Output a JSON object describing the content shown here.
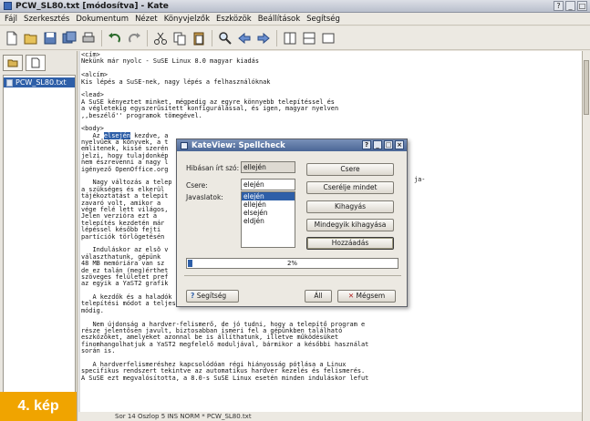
{
  "window": {
    "title": "PCW_SL80.txt [módosítva] - Kate"
  },
  "menu": [
    "Fájl",
    "Szerkesztés",
    "Dokumentum",
    "Nézet",
    "Könyvjelzők",
    "Eszközök",
    "Beállítások",
    "Segítség"
  ],
  "toolbar_icons": [
    "new-icon",
    "open-icon",
    "save-icon",
    "save-all-icon",
    "print-icon",
    "undo-icon",
    "redo-icon",
    "cut-icon",
    "copy-icon",
    "paste-icon",
    "find-icon",
    "back-icon",
    "forward-icon",
    "split-vertical-icon",
    "split-horizontal-icon",
    "close-view-icon"
  ],
  "sidebar": {
    "file": "PCW_SL80.txt"
  },
  "editor": {
    "lines": [
      "<cím>",
      "Nekünk már nyolc - SuSE Linux 8.0 magyar kiadás",
      "",
      "<alcím>",
      "Kis lépés a SuSE-nek, nagy lépés a felhasználóknak",
      "",
      "<lead>",
      "A SuSE kényeztet minket, mégpedig az egyre könnyebb telepítéssel és",
      "a végletekig egyszerűsített konfigurálással, és igen, magyar nyelven",
      ",,beszélő'' programok tömegével.",
      "",
      "<body>",
      "   Az elsején kezdve, a",
      "nyelvűek a könyvek, a t",
      "emlitenek, kissé szerén",
      "jelzi, hogy tulajdonkép",
      "nem észrevenni a nagy l",
      "igényező OpenOffice.org",
      "",
      "   Nagy változás a telep",
      "a szükséges és elkerül",
      "tájékoztatást a telepít",
      "zavaró volt, amikor a ",
      "vége felé lett világos,",
      "Jelen verzióra ezt a ",
      "telepítés kezdetén már",
      "lépéssel később fejti ",
      "partíciók törlögetésén",
      "",
      "   Induláskor az elsõ v",
      "választhatunk, gépünk",
      "48 MB memóriára van sz",
      "de ez talán (meg)érthet",
      "szöveges felületet pref",
      "az egyik a YaST2 grafik",
      "",
      "   A kezdők és a haladók kedvükre választhatnak maguknak megfelelõ",
      "telepítési módot a teljesen automatikustól kezdve egészen a manuális",
      "módig.",
      "",
      "   Nem újdonság a hardver-felismerő, de jó tudni, hogy a telepítő program e",
      "része jelentősen javult, biztosabban ismeri fel a gépünkben található",
      "eszközöket, amelyeket azonnal be is állíthatunk, illetve működésüket",
      "finomhangolhatjuk a YaST2 megfelelő moduljával, bármikor a későbbi használat",
      "során is.",
      "",
      "   A hardverfelismeréshez kapcsolódóan régi hiányosság pótlása a Linux",
      "specifikus rendszert tekintve az automatikus hardver kezelés és felismerés.",
      "A SuSE ezt megvalósította, a 8.0-s SuSE Linux esetén minden induláskor lefut"
    ],
    "side_note": "ja-"
  },
  "statusbar": "Sor 14 Oszlop 5 INS NORM * PCW_SL80.txt",
  "caption": "4. kép",
  "dialog": {
    "title": "KateView: Spellcheck",
    "misspelled_label": "Hibásan írt szó:",
    "misspelled_value": "ellején",
    "replace_label": "Csere:",
    "replace_value": "elején",
    "suggestions_label": "Javaslatok:",
    "suggestions": [
      "elején",
      "ellején",
      "elsején",
      "eldjén"
    ],
    "selected_suggestion": 0,
    "buttons": {
      "replace": "Csere",
      "replace_all": "Cserélje mindet",
      "ignore": "Kihagyás",
      "ignore_all": "Mindegyik kihagyása",
      "add": "Hozzáadás",
      "help": "Segítség",
      "ok": "Áll",
      "cancel": "Mégsem"
    },
    "progress": {
      "percent": 2,
      "label": "2%"
    }
  }
}
